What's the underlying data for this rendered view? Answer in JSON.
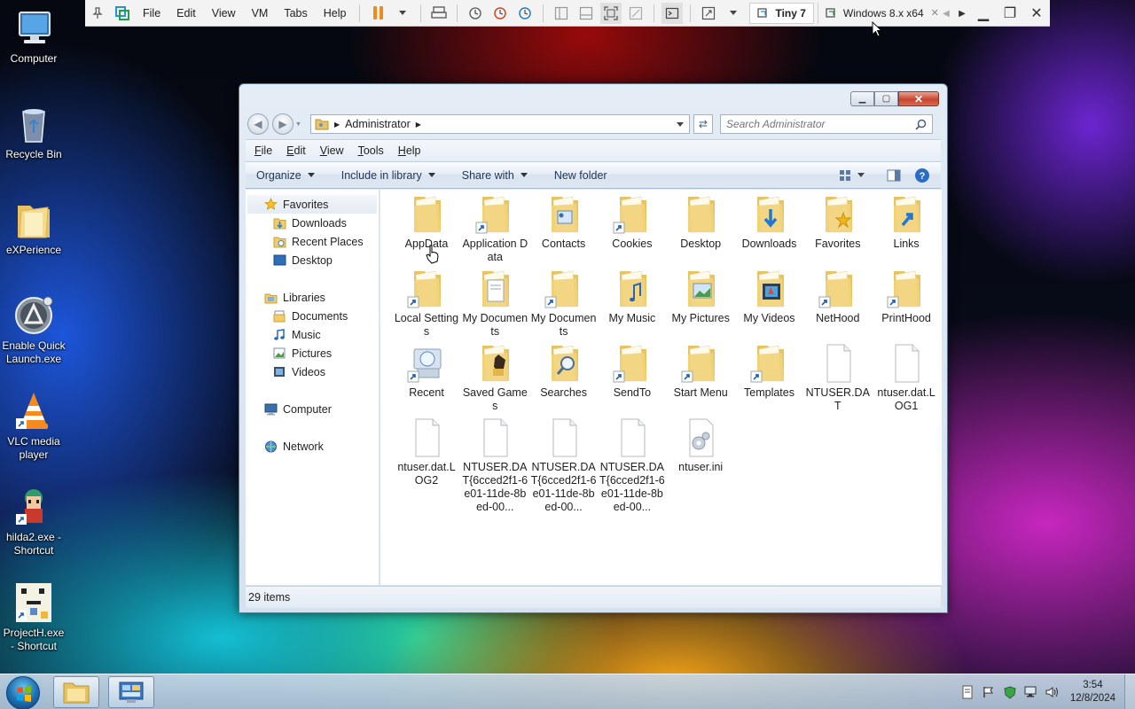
{
  "vm_toolbar": {
    "menus": [
      "File",
      "Edit",
      "View",
      "VM",
      "Tabs",
      "Help"
    ],
    "tabs": [
      {
        "label": "Tiny 7",
        "active": true
      },
      {
        "label": "Windows 8.x x64",
        "active": false
      }
    ]
  },
  "desktop_icons": [
    {
      "label": "Computer",
      "icon": "computer-icon"
    },
    {
      "label": "Recycle Bin",
      "icon": "recycle-bin-icon"
    },
    {
      "label": "eXPerience",
      "icon": "folder-icon"
    },
    {
      "label": "Enable Quick Launch.exe",
      "icon": "quick-launch-icon"
    },
    {
      "label": "VLC media player",
      "icon": "vlc-icon"
    },
    {
      "label": "hilda2.exe - Shortcut",
      "icon": "game-character-icon"
    },
    {
      "label": "ProjectH.exe - Shortcut",
      "icon": "pixel-art-icon"
    }
  ],
  "explorer": {
    "address": {
      "crumb": "Administrator"
    },
    "search": {
      "placeholder": "Search Administrator"
    },
    "menubar": [
      "File",
      "Edit",
      "View",
      "Tools",
      "Help"
    ],
    "commands": {
      "organize": "Organize",
      "include": "Include in library",
      "share": "Share with",
      "new_folder": "New folder"
    },
    "nav": {
      "favorites": "Favorites",
      "favorites_items": [
        "Downloads",
        "Recent Places",
        "Desktop"
      ],
      "libraries": "Libraries",
      "libraries_items": [
        "Documents",
        "Music",
        "Pictures",
        "Videos"
      ],
      "computer": "Computer",
      "network": "Network"
    },
    "items": [
      {
        "label": "AppData",
        "type": "folder"
      },
      {
        "label": "Application Data",
        "type": "shortcut-folder"
      },
      {
        "label": "Contacts",
        "type": "folder-contacts"
      },
      {
        "label": "Cookies",
        "type": "shortcut-folder"
      },
      {
        "label": "Desktop",
        "type": "folder"
      },
      {
        "label": "Downloads",
        "type": "folder-downloads"
      },
      {
        "label": "Favorites",
        "type": "folder-favorites"
      },
      {
        "label": "Links",
        "type": "folder-links"
      },
      {
        "label": "Local Settings",
        "type": "shortcut-folder"
      },
      {
        "label": "My Documents",
        "type": "folder-documents"
      },
      {
        "label": "My Documents",
        "type": "shortcut-folder"
      },
      {
        "label": "My Music",
        "type": "folder-music"
      },
      {
        "label": "My Pictures",
        "type": "folder-pictures"
      },
      {
        "label": "My Videos",
        "type": "folder-videos"
      },
      {
        "label": "NetHood",
        "type": "shortcut-folder"
      },
      {
        "label": "PrintHood",
        "type": "shortcut-folder"
      },
      {
        "label": "Recent",
        "type": "shortcut-recent"
      },
      {
        "label": "Saved Games",
        "type": "folder-games"
      },
      {
        "label": "Searches",
        "type": "folder-searches"
      },
      {
        "label": "SendTo",
        "type": "shortcut-folder"
      },
      {
        "label": "Start Menu",
        "type": "shortcut-folder"
      },
      {
        "label": "Templates",
        "type": "shortcut-folder"
      },
      {
        "label": "NTUSER.DAT",
        "type": "file"
      },
      {
        "label": "ntuser.dat.LOG1",
        "type": "file"
      },
      {
        "label": "ntuser.dat.LOG2",
        "type": "file"
      },
      {
        "label": "NTUSER.DAT{6cced2f1-6e01-11de-8bed-00...",
        "type": "file"
      },
      {
        "label": "NTUSER.DAT{6cced2f1-6e01-11de-8bed-00...",
        "type": "file"
      },
      {
        "label": "NTUSER.DAT{6cced2f1-6e01-11de-8bed-00...",
        "type": "file"
      },
      {
        "label": "ntuser.ini",
        "type": "file-settings"
      }
    ],
    "status": "29 items"
  },
  "taskbar": {
    "clock_time": "3:54",
    "clock_date": "12/8/2024"
  },
  "colors": {
    "folder": "#f2d37a",
    "accent": "#1f6fc5"
  }
}
